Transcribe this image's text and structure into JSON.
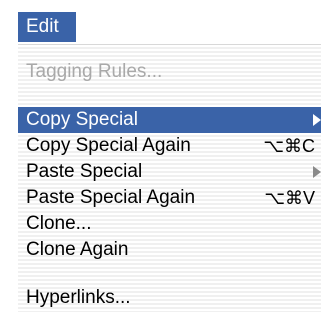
{
  "menubar": {
    "title": "Edit",
    "accent": "#3a63a8"
  },
  "menu": {
    "items": [
      {
        "label": "Tagging Rules...",
        "enabled": false
      },
      {
        "label": "Copy Special",
        "enabled": true,
        "highlighted": true,
        "submenu": true
      },
      {
        "label": "Copy Special Again",
        "enabled": true,
        "shortcut": "⌥⌘C"
      },
      {
        "label": "Paste Special",
        "enabled": true,
        "submenu": true
      },
      {
        "label": "Paste Special Again",
        "enabled": true,
        "shortcut": "⌥⌘V"
      },
      {
        "label": "Clone...",
        "enabled": true
      },
      {
        "label": "Clone Again",
        "enabled": true
      },
      {
        "label": "Hyperlinks...",
        "enabled": true
      }
    ],
    "icons": {
      "submenu_arrow": "chevron-right-icon"
    }
  }
}
